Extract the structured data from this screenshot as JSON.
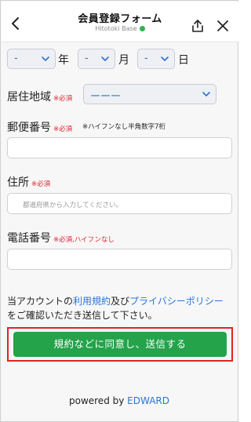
{
  "header": {
    "title": "会員登録フォーム",
    "subtitle": "Hitotoki Base",
    "back_icon": "chevron-left-icon",
    "share_icon": "share-icon",
    "close_icon": "close-icon"
  },
  "birthdate": {
    "year_value": "-",
    "year_unit": "年",
    "month_value": "-",
    "month_unit": "月",
    "day_value": "-",
    "day_unit": "日"
  },
  "region": {
    "label": "居住地域",
    "required": "※必須",
    "value": "ーーー"
  },
  "postal": {
    "label": "郵便番号",
    "required": "※必須",
    "note": "※ハイフンなし半角数字7桁",
    "value": ""
  },
  "address": {
    "label": "住所",
    "required": "※必須",
    "placeholder": "都道府県から入力してください。",
    "value": ""
  },
  "phone": {
    "label": "電話番号",
    "required": "※必須,ハイフンなし",
    "value": ""
  },
  "consent": {
    "prefix": "当アカウントの",
    "terms_link": "利用規約",
    "and": "及び",
    "privacy_link": "プライバシーポリシー",
    "suffix": "をご確認いただき送信して下さい。"
  },
  "submit_label": "規約などに同意し、送信する",
  "footer": {
    "powered_by": "powered by",
    "brand": "EDWARD"
  },
  "colors": {
    "accent_blue": "#2a74d6",
    "submit_green": "#24a34a",
    "required_red": "#e0212b",
    "highlight_red": "#e22323",
    "brand_dot": "#2db34a"
  }
}
